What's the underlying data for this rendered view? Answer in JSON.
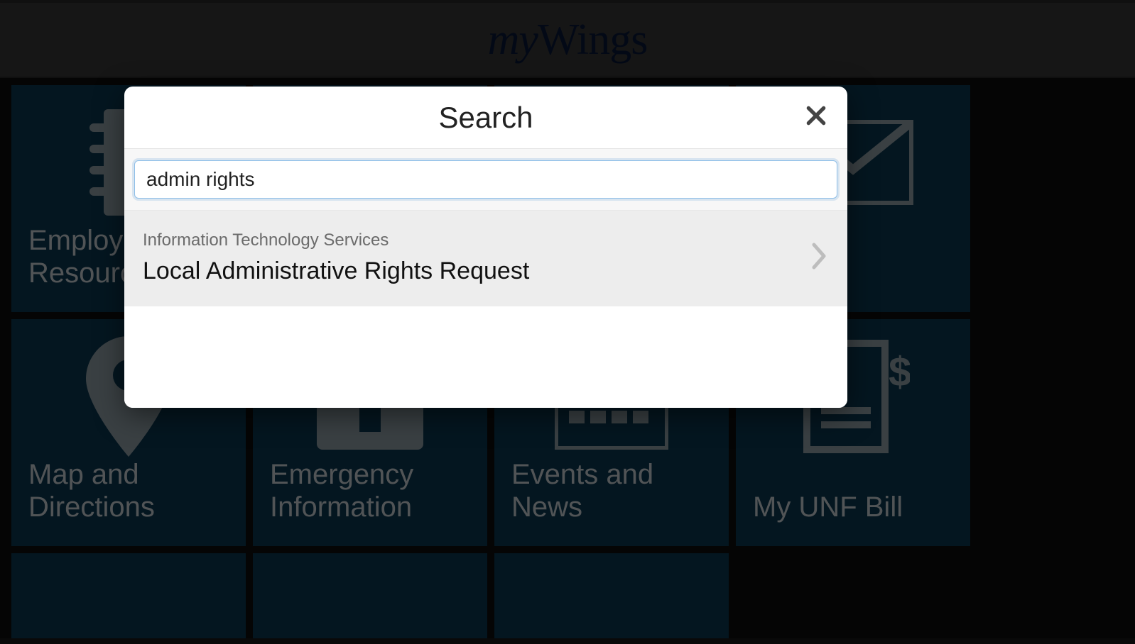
{
  "header": {
    "brand_my": "my",
    "brand_wings": "Wings"
  },
  "tiles": {
    "employee_resources": "Employee Resources",
    "map_directions": "Map and Directions",
    "emergency_info": "Emergency Information",
    "events_news": "Events and News",
    "my_unf_bill": "My UNF Bill"
  },
  "modal": {
    "title": "Search",
    "search_value": "admin rights",
    "result": {
      "category": "Information Technology Services",
      "title": "Local Administrative Rights Request"
    }
  }
}
